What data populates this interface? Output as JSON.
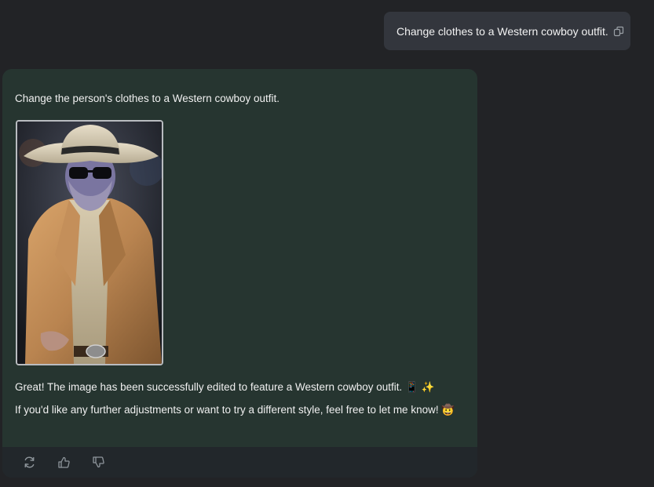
{
  "user_message": {
    "text": "Change clothes to a Western cowboy outfit.",
    "copy_icon": "copy-icon"
  },
  "assistant_message": {
    "prompt": "Change the person's clothes to a Western cowboy outfit.",
    "image_alt": "cowboy-outfit-result-image",
    "reply_line_1": "Great! The image has been successfully edited to feature a Western cowboy outfit. 📱 ✨",
    "reply_line_2": "If you'd like any further adjustments or want to try a different style, feel free to let me know! 🤠"
  },
  "actions": [
    {
      "icon": "regenerate-icon"
    },
    {
      "icon": "thumbs-up-icon"
    },
    {
      "icon": "thumbs-down-icon"
    }
  ],
  "colors": {
    "page_background": "#222326",
    "user_bubble": "#33363d",
    "assistant_card": "#263530",
    "action_bar": "#22272b"
  }
}
